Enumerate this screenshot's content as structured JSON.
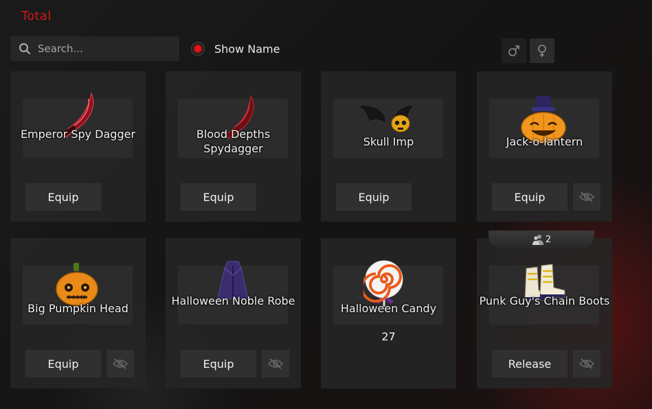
{
  "header": {
    "title": "Total"
  },
  "search": {
    "placeholder": "Search..."
  },
  "toggle": {
    "label": "Show Name",
    "checked": true
  },
  "gender_filters": [
    {
      "symbol": "♂",
      "name": "male"
    },
    {
      "symbol": "♀",
      "name": "female"
    }
  ],
  "items": [
    {
      "name": "Emperor Spy Dagger",
      "action": "Equip"
    },
    {
      "name": "Blood Depths Spydagger",
      "action": "Equip"
    },
    {
      "name": "Skull Imp",
      "action": "Equip"
    },
    {
      "name": "Jack-o-lantern",
      "action": "Equip"
    },
    {
      "name": "Big Pumpkin Head",
      "action": "Equip"
    },
    {
      "name": "Halloween Noble Robe",
      "action": "Equip"
    },
    {
      "name": "Halloween Candy",
      "quantity": "27"
    },
    {
      "name": "Punk Guy's Chain Boots",
      "action": "Release"
    }
  ],
  "owner_badge": {
    "count": "2"
  },
  "colors": {
    "accent": "#d21616",
    "card": "#262626"
  }
}
